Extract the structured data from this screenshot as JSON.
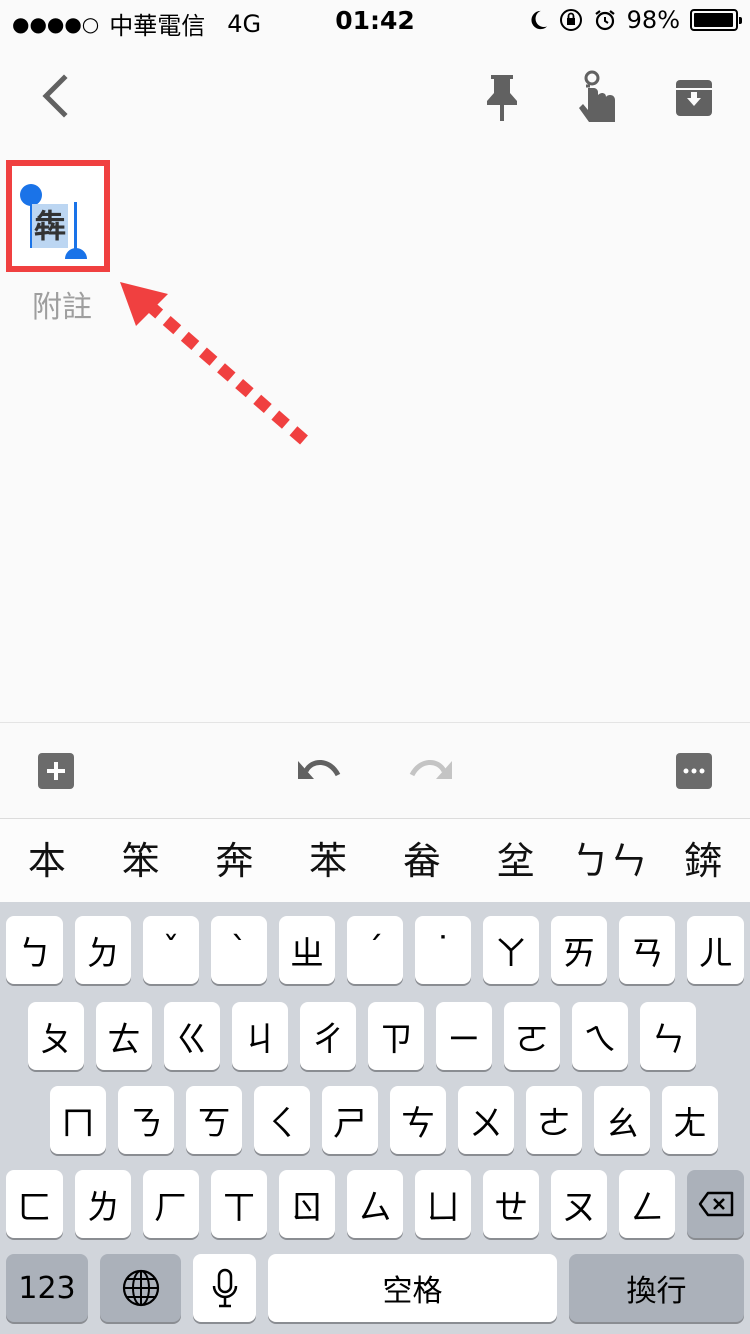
{
  "status": {
    "carrier": "中華電信",
    "network": "4G",
    "time": "01:42",
    "battery": "98%",
    "battery_level": 0.98,
    "signal_dots": "●●●●○"
  },
  "toolbar": {
    "back_icon": "chevron-left-icon",
    "pin_icon": "pin-icon",
    "reminder_icon": "reminder-hand-icon",
    "archive_icon": "archive-icon"
  },
  "note": {
    "title": "犇",
    "body": "附註"
  },
  "edit_toolbar": {
    "add_icon": "plus-box-icon",
    "undo_icon": "undo-icon",
    "redo_icon": "redo-icon",
    "more_icon": "more-horizontal-icon"
  },
  "candidates": [
    "本",
    "笨",
    "奔",
    "苯",
    "畚",
    "坌",
    "ㄅㄣ",
    "錛"
  ],
  "keyboard": {
    "row1": [
      "ㄅ",
      "ㄉ",
      "ˇ",
      "ˋ",
      "ㄓ",
      "ˊ",
      "˙",
      "ㄚ",
      "ㄞ",
      "ㄢ",
      "ㄦ"
    ],
    "row2": [
      "ㄆ",
      "ㄊ",
      "ㄍ",
      "ㄐ",
      "ㄔ",
      "ㄗ",
      "ㄧ",
      "ㄛ",
      "ㄟ",
      "ㄣ"
    ],
    "row3": [
      "ㄇ",
      "ㄋ",
      "ㄎ",
      "ㄑ",
      "ㄕ",
      "ㄘ",
      "ㄨ",
      "ㄜ",
      "ㄠ",
      "ㄤ"
    ],
    "row4": [
      "ㄈ",
      "ㄌ",
      "ㄏ",
      "ㄒ",
      "ㄖ",
      "ㄙ",
      "ㄩ",
      "ㄝ",
      "ㄡ",
      "ㄥ"
    ],
    "numbers_label": "123",
    "space_label": "空格",
    "return_label": "換行"
  },
  "colors": {
    "annotation": "#f04040",
    "selection_handle": "#1a73e8",
    "selection_bg": "#bcd6f2"
  }
}
